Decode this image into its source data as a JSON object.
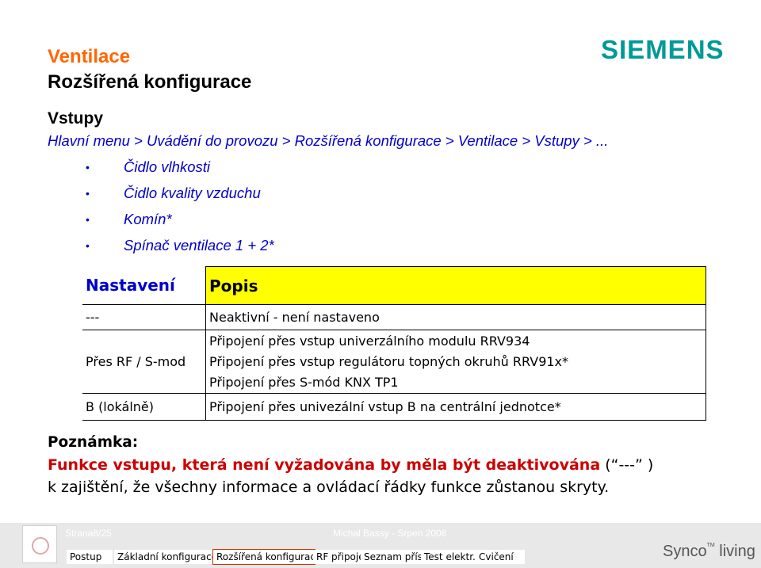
{
  "header": {
    "title": "Ventilace",
    "subtitle": "Rozšířená konfigurace",
    "brand": "SIEMENS"
  },
  "section": {
    "title": "Vstupy",
    "path": "Hlavní menu > Uvádění do provozu > Rozšířená konfigurace > Ventilace > Vstupy > ...",
    "bullet_glyph": "•",
    "bullets": [
      "Čidlo vlhkosti",
      "Čidlo kvality vzduchu",
      "Komín*",
      "Spínač ventilace 1 + 2*"
    ]
  },
  "table": {
    "headers": [
      "Nastavení",
      "Popis"
    ],
    "rows": [
      {
        "setting": "---",
        "desc": [
          "Neaktivní - není nastaveno"
        ]
      },
      {
        "setting": "Přes RF / S-mod",
        "desc": [
          "Připojení přes vstup univerzálního modulu RRV934",
          "Připojení přes vstup regulátoru topných okruhů RRV91x*",
          "Připojení přes S-mód KNX TP1"
        ]
      },
      {
        "setting": "B (lokálně)",
        "desc": [
          "Připojení přes univezální vstup B na centrální jednotce*"
        ]
      }
    ]
  },
  "note": {
    "title": "Poznámka:",
    "line1_red": "Funkce vstupu, která není vyžadována by měla být deaktivována",
    "line1_plain": " (“---” )",
    "line2": "k zajištění, že všechny informace a ovládací řádky funkce zůstanou skryty."
  },
  "footer": {
    "page": "Strana8/25",
    "author": "Michal Bassy - Srpen 2008",
    "nav": [
      "Postup",
      "Základní konfigurace",
      "Rozšířená konfigurace",
      "RF připojení",
      "Seznam přístr.",
      "Test elektr. zapojení",
      "Cvičení"
    ],
    "synco": "Synco",
    "synco_tm": "TM",
    "synco_living": " living"
  },
  "colors": {
    "accent": "#ff6600",
    "brand": "#009999",
    "link": "#0000cc",
    "highlight": "#ffff00",
    "warning": "#cc0000"
  }
}
